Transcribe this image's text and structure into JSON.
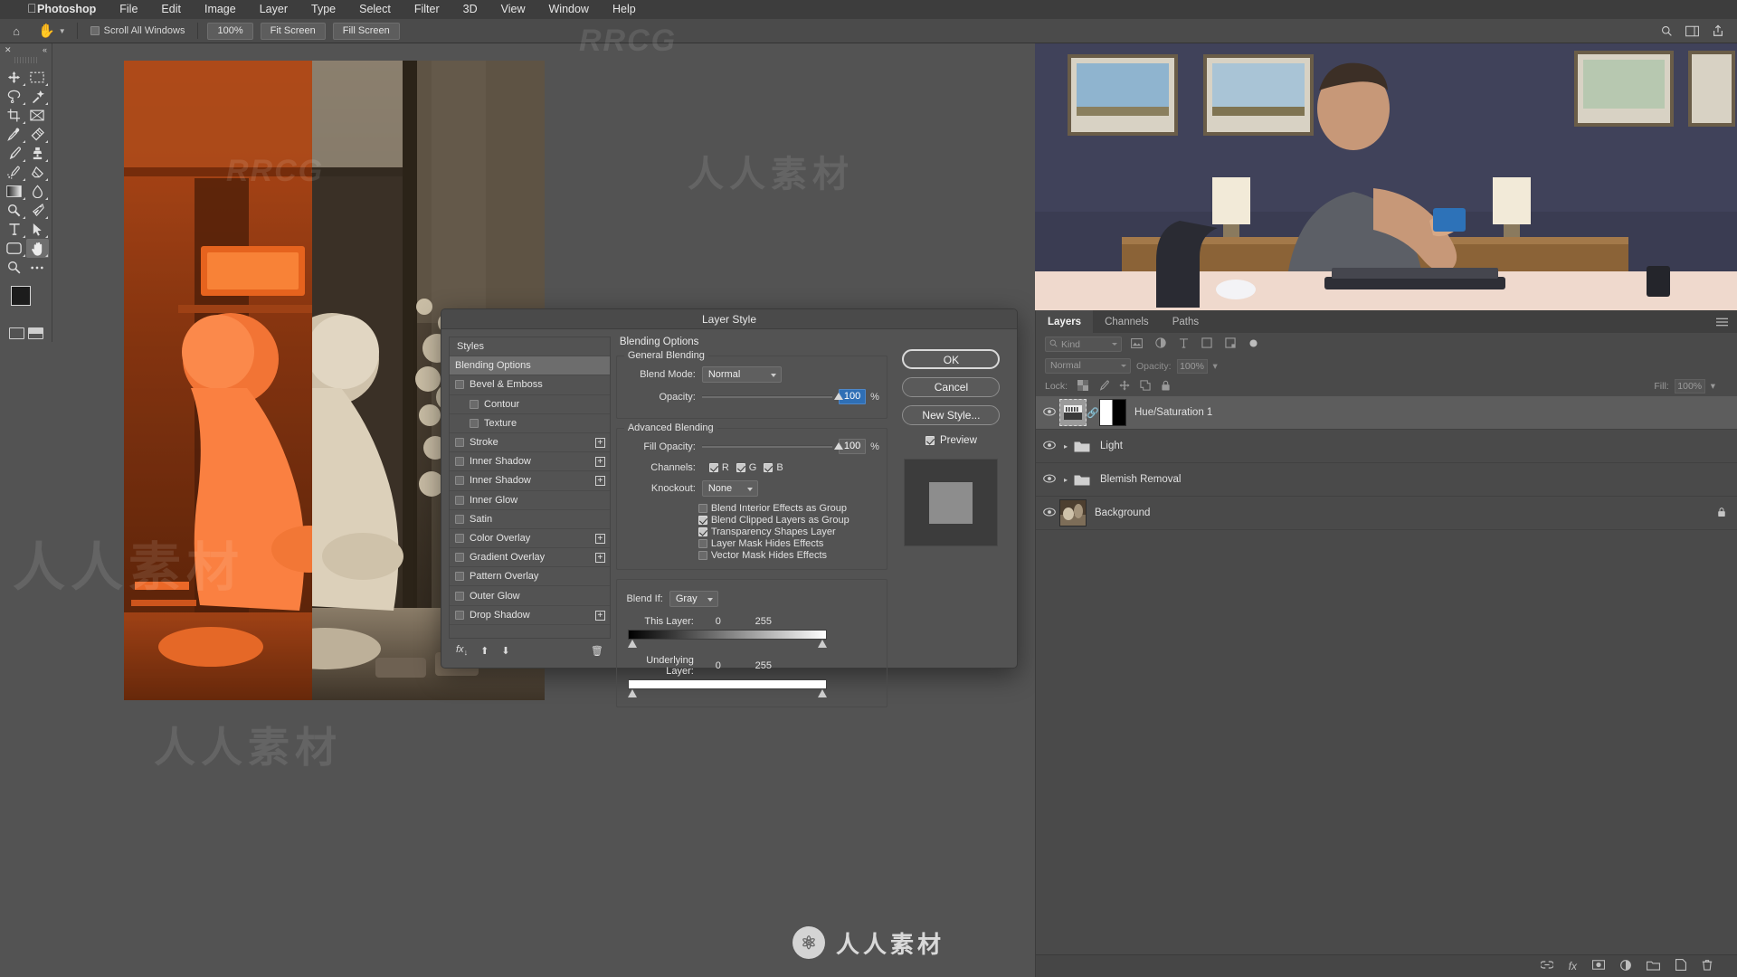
{
  "app": {
    "name": "Photoshop",
    "dialog_title": "Layer Style"
  },
  "menubar": {
    "apple": "apple-logo",
    "items": [
      "Photoshop",
      "File",
      "Edit",
      "Image",
      "Layer",
      "Type",
      "Select",
      "Filter",
      "3D",
      "View",
      "Window",
      "Help"
    ]
  },
  "options_bar": {
    "home_icon": "home-icon",
    "tool_icon": "hand-tool-icon",
    "scroll_all_windows": "Scroll All Windows",
    "scroll_all_windows_checked": false,
    "zoom_100": "100%",
    "fit_screen": "Fit Screen",
    "fill_screen": "Fill Screen",
    "right_icons": [
      "search-icon",
      "workspace-icon",
      "share-icon"
    ]
  },
  "toolbox": {
    "tools": [
      {
        "name": "move-tool",
        "glyph": "move"
      },
      {
        "name": "rectangular-marquee-tool",
        "glyph": "marquee"
      },
      {
        "name": "lasso-tool",
        "glyph": "lasso"
      },
      {
        "name": "quick-selection-tool",
        "glyph": "wand"
      },
      {
        "name": "crop-tool",
        "glyph": "crop"
      },
      {
        "name": "frame-tool",
        "glyph": "frame"
      },
      {
        "name": "eyedropper-tool",
        "glyph": "eyedropper"
      },
      {
        "name": "spot-healing-brush-tool",
        "glyph": "healing"
      },
      {
        "name": "brush-tool",
        "glyph": "brush"
      },
      {
        "name": "clone-stamp-tool",
        "glyph": "stamp"
      },
      {
        "name": "history-brush-tool",
        "glyph": "historybrush"
      },
      {
        "name": "eraser-tool",
        "glyph": "eraser"
      },
      {
        "name": "gradient-tool",
        "glyph": "gradient"
      },
      {
        "name": "blur-tool",
        "glyph": "blur"
      },
      {
        "name": "dodge-tool",
        "glyph": "dodge"
      },
      {
        "name": "pen-tool",
        "glyph": "pen"
      },
      {
        "name": "horizontal-type-tool",
        "glyph": "type"
      },
      {
        "name": "path-selection-tool",
        "glyph": "pathselect"
      },
      {
        "name": "rectangle-tool",
        "glyph": "rectangle"
      },
      {
        "name": "hand-tool",
        "glyph": "hand"
      },
      {
        "name": "zoom-tool",
        "glyph": "zoom"
      },
      {
        "name": "edit-toolbar-tool",
        "glyph": "ellipsis"
      }
    ],
    "selected_tool": "hand-tool",
    "foreground_color": "#1c1c1c",
    "background_color": "#ffffff"
  },
  "dialog": {
    "title": "Layer Style",
    "styles": {
      "header": "Styles",
      "items": [
        {
          "label": "Blending Options",
          "checkbox": false,
          "checked": false,
          "selected": true,
          "indent": 0,
          "plus": false
        },
        {
          "label": "Bevel & Emboss",
          "checkbox": true,
          "checked": false,
          "selected": false,
          "indent": 0,
          "plus": false
        },
        {
          "label": "Contour",
          "checkbox": true,
          "checked": false,
          "selected": false,
          "indent": 1,
          "plus": false
        },
        {
          "label": "Texture",
          "checkbox": true,
          "checked": false,
          "selected": false,
          "indent": 1,
          "plus": false
        },
        {
          "label": "Stroke",
          "checkbox": true,
          "checked": false,
          "selected": false,
          "indent": 0,
          "plus": true
        },
        {
          "label": "Inner Shadow",
          "checkbox": true,
          "checked": false,
          "selected": false,
          "indent": 0,
          "plus": true
        },
        {
          "label": "Inner Shadow",
          "checkbox": true,
          "checked": false,
          "selected": false,
          "indent": 0,
          "plus": true
        },
        {
          "label": "Inner Glow",
          "checkbox": true,
          "checked": false,
          "selected": false,
          "indent": 0,
          "plus": false
        },
        {
          "label": "Satin",
          "checkbox": true,
          "checked": false,
          "selected": false,
          "indent": 0,
          "plus": false
        },
        {
          "label": "Color Overlay",
          "checkbox": true,
          "checked": false,
          "selected": false,
          "indent": 0,
          "plus": true
        },
        {
          "label": "Gradient Overlay",
          "checkbox": true,
          "checked": false,
          "selected": false,
          "indent": 0,
          "plus": true
        },
        {
          "label": "Pattern Overlay",
          "checkbox": true,
          "checked": false,
          "selected": false,
          "indent": 0,
          "plus": false
        },
        {
          "label": "Outer Glow",
          "checkbox": true,
          "checked": false,
          "selected": false,
          "indent": 0,
          "plus": false
        },
        {
          "label": "Drop Shadow",
          "checkbox": true,
          "checked": false,
          "selected": false,
          "indent": 0,
          "plus": true
        }
      ],
      "footer_icons": [
        "fx-icon",
        "move-up-icon",
        "move-down-icon",
        "delete-icon"
      ]
    },
    "blending": {
      "title": "Blending Options",
      "general": {
        "legend": "General Blending",
        "blend_mode_label": "Blend Mode:",
        "blend_mode_value": "Normal",
        "opacity_label": "Opacity:",
        "opacity_value": "100",
        "opacity_unit": "%"
      },
      "advanced": {
        "legend": "Advanced Blending",
        "fill_opacity_label": "Fill Opacity:",
        "fill_opacity_value": "100",
        "fill_opacity_unit": "%",
        "channels_label": "Channels:",
        "channels": [
          {
            "label": "R",
            "checked": true
          },
          {
            "label": "G",
            "checked": true
          },
          {
            "label": "B",
            "checked": true
          }
        ],
        "knockout_label": "Knockout:",
        "knockout_value": "None",
        "checkboxes": [
          {
            "label": "Blend Interior Effects as Group",
            "checked": false
          },
          {
            "label": "Blend Clipped Layers as Group",
            "checked": true
          },
          {
            "label": "Transparency Shapes Layer",
            "checked": true
          },
          {
            "label": "Layer Mask Hides Effects",
            "checked": false
          },
          {
            "label": "Vector Mask Hides Effects",
            "checked": false
          }
        ]
      },
      "blend_if": {
        "label": "Blend If:",
        "value": "Gray",
        "this_layer_label": "This Layer:",
        "this_layer_min": "0",
        "this_layer_max": "255",
        "underlying_layer_label": "Underlying Layer:",
        "underlying_layer_min": "0",
        "underlying_layer_max": "255"
      }
    },
    "buttons": {
      "ok": "OK",
      "cancel": "Cancel",
      "new_style": "New Style...",
      "preview_label": "Preview",
      "preview_checked": true
    }
  },
  "layers_panel": {
    "tabs": [
      {
        "label": "Layers",
        "active": true
      },
      {
        "label": "Channels",
        "active": false
      },
      {
        "label": "Paths",
        "active": false
      }
    ],
    "menu_icon": "panel-menu-icon",
    "filter": {
      "search_icon": "search-icon",
      "kind_label": "Kind",
      "icons": [
        "pixel-filter-icon",
        "adjustment-filter-icon",
        "type-filter-icon",
        "shape-filter-icon",
        "smartobject-filter-icon",
        "effects-toggle-icon"
      ]
    },
    "blend": {
      "mode": "Normal",
      "opacity_label": "Opacity:",
      "opacity_value": "100%"
    },
    "lock": {
      "label": "Lock:",
      "icons": [
        "lock-transparent-pixels-icon",
        "lock-image-pixels-icon",
        "lock-position-icon",
        "lock-artboard-icon",
        "lock-all-icon"
      ],
      "fill_label": "Fill:",
      "fill_value": "100%"
    },
    "layers": [
      {
        "name": "Hue/Saturation 1",
        "type": "adjustment",
        "visible": true,
        "selected": true,
        "locked": false,
        "expandable": false
      },
      {
        "name": "Light",
        "type": "group",
        "visible": true,
        "selected": false,
        "locked": false,
        "expandable": true
      },
      {
        "name": "Blemish Removal",
        "type": "group",
        "visible": true,
        "selected": false,
        "locked": false,
        "expandable": true
      },
      {
        "name": "Background",
        "type": "image",
        "visible": true,
        "selected": false,
        "locked": true,
        "expandable": false
      }
    ],
    "footer_icons": [
      "link-layers-icon",
      "add-layer-style-icon",
      "add-layer-mask-icon",
      "new-adjustment-layer-icon",
      "new-group-icon",
      "new-layer-icon",
      "delete-layer-icon"
    ]
  },
  "dock": {
    "icons": [
      "color-panel-icon",
      "adjustments-panel-icon",
      "libraries-panel-icon",
      "properties-panel-icon",
      "brush-settings-icon",
      "timeline-icon",
      "character-panel-icon",
      "paragraph-panel-icon"
    ]
  },
  "watermarks": {
    "cn": "人人素材",
    "en": "RRCG",
    "bottom": "人人素材",
    "logo": "rrcg-logo"
  },
  "colors": {
    "window_bg": "#535353",
    "panel_bg": "#4a4a4a",
    "menubar_bg": "#3d3d3d",
    "accent_selected": "#2f6fb5",
    "text": "#e4e4e4"
  }
}
